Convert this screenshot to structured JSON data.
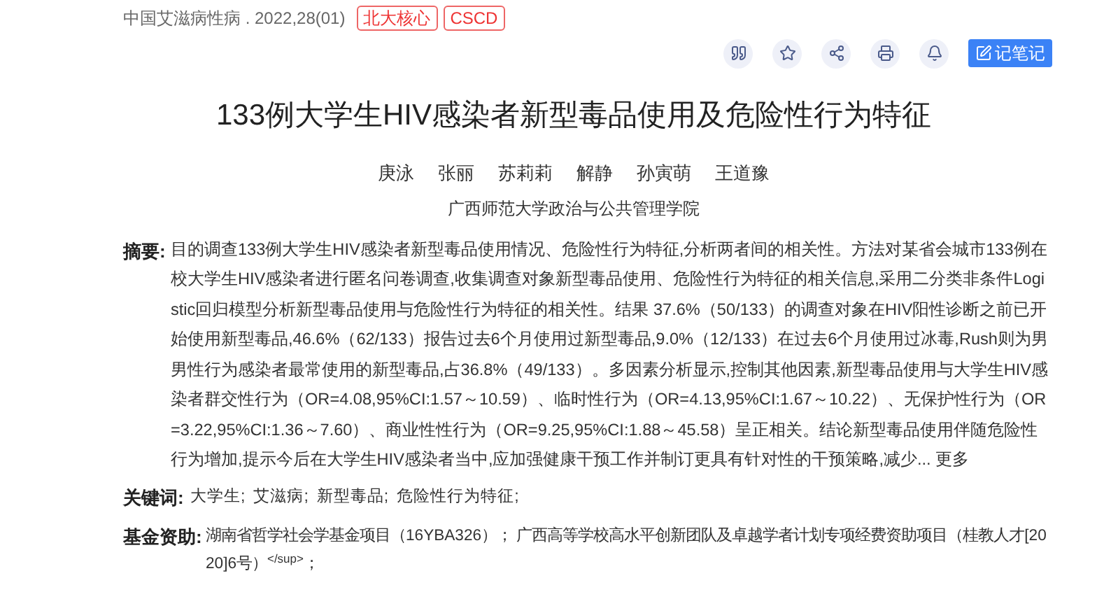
{
  "source": {
    "journal": "中国艾滋病性病 . 2022,28(01)",
    "tags": [
      "北大核心",
      "CSCD"
    ]
  },
  "toolbar": {
    "note_button": "记笔记"
  },
  "title": "133例大学生HIV感染者新型毒品使用及危险性行为特征",
  "authors": [
    "庚泳",
    "张丽",
    "苏莉莉",
    "解静",
    "孙寅萌",
    "王道豫"
  ],
  "affiliation": "广西师范大学政治与公共管理学院",
  "abstract": {
    "label": "摘要:",
    "text": "目的调查133例大学生HIV感染者新型毒品使用情况、危险性行为特征,分析两者间的相关性。方法对某省会城市133例在校大学生HIV感染者进行匿名问卷调查,收集调查对象新型毒品使用、危险性行为特征的相关信息,采用二分类非条件Logistic回归模型分析新型毒品使用与危险性行为特征的相关性。结果 37.6%（50/133）的调查对象在HIV阳性诊断之前已开始使用新型毒品,46.6%（62/133）报告过去6个月使用过新型毒品,9.0%（12/133）在过去6个月使用过冰毒,Rush则为男男性行为感染者最常使用的新型毒品,占36.8%（49/133）。多因素分析显示,控制其他因素,新型毒品使用与大学生HIV感染者群交性行为（OR=4.08,95%CI:1.57～10.59）、临时性行为（OR=4.13,95%CI:1.67～10.22）、无保护性行为（OR=3.22,95%CI:1.36～7.60）、商业性性行为（OR=9.25,95%CI:1.88～45.58）呈正相关。结论新型毒品使用伴随危险性行为增加,提示今后在大学生HIV感染者当中,应加强健康干预工作并制订更具有针对性的干预策略,减少...",
    "more": "更多"
  },
  "keywords": {
    "label": "关键词:",
    "items": [
      "大学生;",
      "艾滋病;",
      "新型毒品;",
      "危险性行为特征;"
    ]
  },
  "funding": {
    "label": "基金资助:",
    "text": "湖南省哲学社会学基金项目（16YBA326）； 广西高等学校高水平创新团队及卓越学者计划专项经费资助项目（桂教人才[2020]6号）$^{</sup>}$；"
  }
}
